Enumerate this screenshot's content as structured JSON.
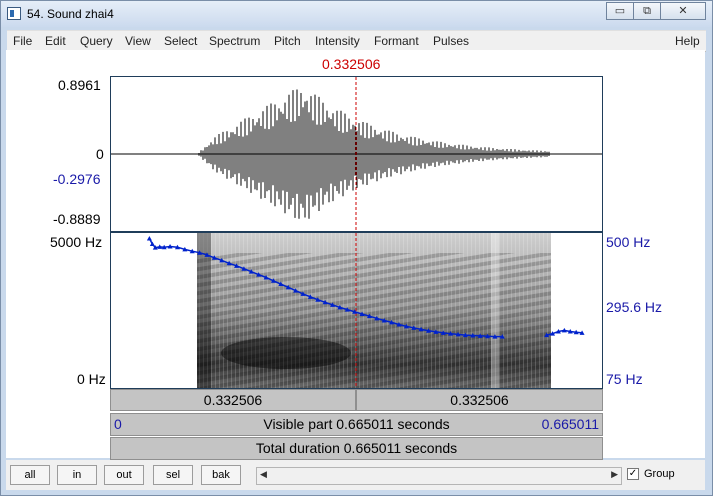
{
  "window": {
    "title": "54. Sound zhai4",
    "minimize": "▭",
    "restore": "⧉",
    "close": "✕"
  },
  "menu": [
    "File",
    "Edit",
    "Query",
    "View",
    "Select",
    "Spectrum",
    "Pitch",
    "Intensity",
    "Formant",
    "Pulses"
  ],
  "help": "Help",
  "cursor_time": "0.332506",
  "waveform": {
    "max": "0.8961",
    "zero": "0",
    "cursor_value": "-0.2976",
    "min": "-0.8889"
  },
  "spectrogram": {
    "freq_top": "5000 Hz",
    "freq_bottom": "0 Hz",
    "pitch_top": "500 Hz",
    "pitch_cursor": "295.6 Hz",
    "pitch_bottom": "75 Hz"
  },
  "pitch_data": {
    "x_unit": "s",
    "y_unit": "Hz",
    "points": [
      [
        0.052,
        485
      ],
      [
        0.056,
        470
      ],
      [
        0.06,
        460
      ],
      [
        0.066,
        462
      ],
      [
        0.072,
        461
      ],
      [
        0.08,
        463
      ],
      [
        0.09,
        461
      ],
      [
        0.1,
        455
      ],
      [
        0.11,
        450
      ],
      [
        0.12,
        446
      ],
      [
        0.13,
        440
      ],
      [
        0.14,
        432
      ],
      [
        0.15,
        425
      ],
      [
        0.16,
        417
      ],
      [
        0.17,
        410
      ],
      [
        0.18,
        402
      ],
      [
        0.19,
        394
      ],
      [
        0.2,
        386
      ],
      [
        0.21,
        378
      ],
      [
        0.22,
        369
      ],
      [
        0.23,
        360
      ],
      [
        0.24,
        351
      ],
      [
        0.25,
        342
      ],
      [
        0.26,
        333
      ],
      [
        0.27,
        325
      ],
      [
        0.28,
        317
      ],
      [
        0.29,
        310
      ],
      [
        0.3,
        303
      ],
      [
        0.31,
        296
      ],
      [
        0.32,
        290
      ],
      [
        0.33,
        284
      ],
      [
        0.34,
        278
      ],
      [
        0.35,
        272
      ],
      [
        0.36,
        266
      ],
      [
        0.37,
        260
      ],
      [
        0.38,
        255
      ],
      [
        0.39,
        249
      ],
      [
        0.4,
        244
      ],
      [
        0.41,
        240
      ],
      [
        0.42,
        236
      ],
      [
        0.43,
        232
      ],
      [
        0.44,
        229
      ],
      [
        0.45,
        226
      ],
      [
        0.46,
        224
      ],
      [
        0.47,
        222
      ],
      [
        0.48,
        220
      ],
      [
        0.49,
        219
      ],
      [
        0.5,
        218
      ],
      [
        0.51,
        217
      ],
      [
        0.52,
        216
      ],
      [
        0.53,
        216
      ],
      [
        0.59,
        220
      ],
      [
        0.598,
        224
      ],
      [
        0.606,
        230
      ],
      [
        0.614,
        233
      ],
      [
        0.622,
        230
      ],
      [
        0.63,
        228
      ],
      [
        0.638,
        226
      ]
    ],
    "ylim": [
      75,
      500
    ],
    "xlim": [
      0,
      0.665011
    ]
  },
  "time_bar": {
    "left": "0.332506",
    "right": "0.332506"
  },
  "visible_bar": {
    "start": "0",
    "label": "Visible part 0.665011 seconds",
    "end": "0.665011"
  },
  "total_bar": {
    "label": "Total duration 0.665011 seconds"
  },
  "buttons": {
    "all": "all",
    "in": "in",
    "out": "out",
    "sel": "sel",
    "bak": "bak"
  },
  "scroll": {
    "left_arrow": "◀",
    "right_arrow": "▶"
  },
  "group": {
    "checked": "✓",
    "label": "Group"
  },
  "colors": {
    "cursor": "#cc0000",
    "pitch": "#0022cc",
    "axis_blue": "#1a1aa8"
  }
}
